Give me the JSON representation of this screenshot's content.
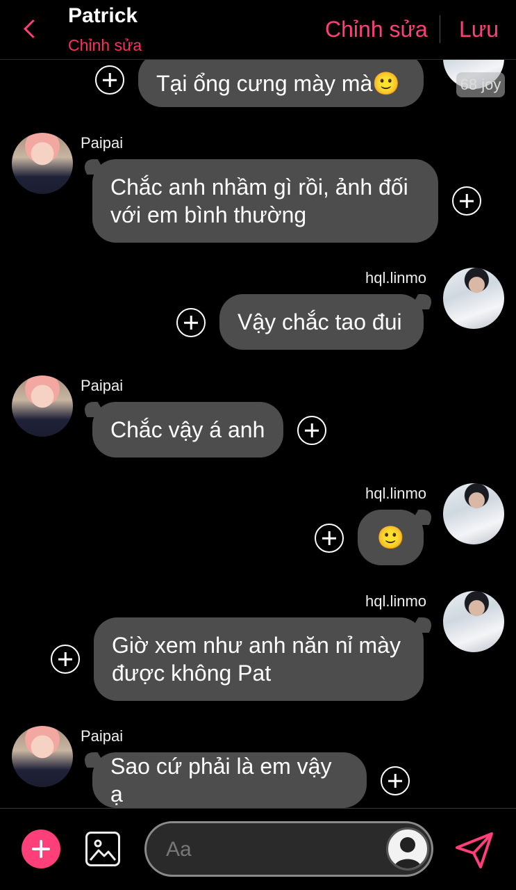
{
  "header": {
    "title": "Patrick",
    "subtitle": "Chỉnh sửa",
    "edit_label": "Chỉnh sửa",
    "save_label": "Lưu"
  },
  "partial_badge": "68 joy",
  "messages": [
    {
      "sender": "hql.linmo",
      "text": "Tại ổng cưng mày mà🙂",
      "side": "right"
    },
    {
      "sender": "Paipai",
      "text": "Chắc anh nhầm gì rồi, ảnh đối với em bình thường",
      "side": "left"
    },
    {
      "sender": "hql.linmo",
      "text": "Vậy chắc tao đui",
      "side": "right"
    },
    {
      "sender": "Paipai",
      "text": "Chắc vậy á anh",
      "side": "left"
    },
    {
      "sender": "hql.linmo",
      "text": "🙂",
      "side": "right"
    },
    {
      "sender": "hql.linmo",
      "text": "Giờ xem như anh năn nỉ mày được không Pat",
      "side": "right"
    },
    {
      "sender": "Paipai",
      "text": "Sao cứ phải là em vậy ạ",
      "side": "left"
    }
  ],
  "composer": {
    "placeholder": "Aa"
  },
  "icons": {
    "back": "chevron-left-icon",
    "add": "plus-icon",
    "image": "image-icon",
    "send": "send-icon"
  },
  "colors": {
    "accent": "#ff3f7a",
    "bubble": "#4d4d4d",
    "background": "#000000"
  }
}
